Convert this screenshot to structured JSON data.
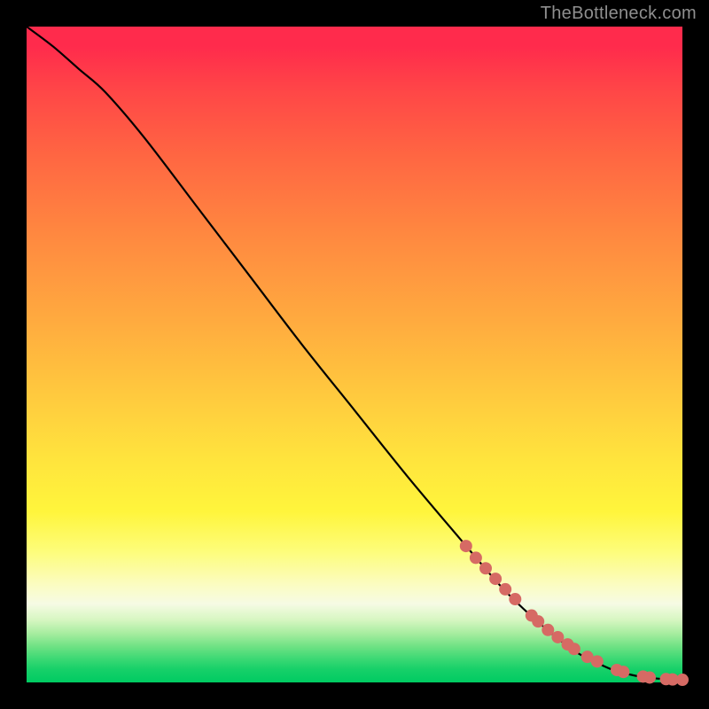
{
  "watermark": "TheBottleneck.com",
  "colors": {
    "background": "#000000",
    "curve": "#000000",
    "dot": "#d66a64",
    "gradient_top": "#ff2b4c",
    "gradient_bottom": "#00cb62"
  },
  "chart_data": {
    "type": "line",
    "title": "",
    "xlabel": "",
    "ylabel": "",
    "xlim": [
      0,
      100
    ],
    "ylim": [
      0,
      100
    ],
    "grid": false,
    "legend": false,
    "series": [
      {
        "name": "curve",
        "x": [
          0,
          4,
          8,
          12,
          18,
          26,
          34,
          42,
          50,
          58,
          66,
          72,
          76,
          80,
          84,
          88,
          90,
          92,
          94,
          96,
          98,
          100
        ],
        "y": [
          100,
          97,
          93.5,
          90,
          83,
          72.5,
          62,
          51.5,
          41.5,
          31.5,
          22,
          15,
          11,
          7.5,
          4.5,
          2.5,
          1.7,
          1.2,
          0.8,
          0.6,
          0.45,
          0.4
        ]
      }
    ],
    "highlight_points": {
      "name": "markers",
      "x": [
        67,
        68.5,
        70,
        71.5,
        73,
        74.5,
        77,
        78,
        79.5,
        81,
        82.5,
        83.5,
        85.5,
        87,
        90,
        91,
        94,
        95,
        97.5,
        98.5,
        100
      ],
      "y": [
        20.8,
        19,
        17.4,
        15.8,
        14.2,
        12.7,
        10.2,
        9.3,
        8,
        6.9,
        5.8,
        5.1,
        3.9,
        3.2,
        1.9,
        1.6,
        0.9,
        0.75,
        0.5,
        0.45,
        0.4
      ]
    }
  }
}
